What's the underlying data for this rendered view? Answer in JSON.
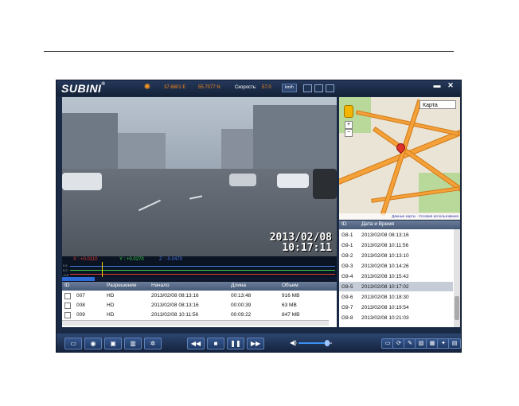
{
  "app": {
    "brand": "SUBINI",
    "brand_sup": "®"
  },
  "titlebar": {
    "latitude": "37.6801 E",
    "longitude": "55.7077 N",
    "speed_label": "Скорость:",
    "speed_value": "57.0",
    "speed_unit": "km/h",
    "minimize_glyph": "▬",
    "close_glyph": "✕",
    "window_icons": [
      "window-single-icon",
      "window-split-icon",
      "window-quad-icon"
    ]
  },
  "video": {
    "date": "2013/02/08",
    "time": "10:17:11"
  },
  "graph": {
    "x_label": "X : +0.0110",
    "y_label": "Y : +0.0270",
    "z_label": "Z : -0.0470",
    "axis_labels": [
      "0.5",
      "0.0",
      "-0.5"
    ],
    "colors": {
      "x": "#e33b3b",
      "y": "#3bd04a",
      "z": "#4a78e8"
    }
  },
  "playback": {
    "progress": 0.12
  },
  "files": {
    "columns": [
      "ID",
      "Разрешение",
      "Начало",
      "Длина",
      "Объем"
    ],
    "rows": [
      {
        "id": "007",
        "res": "HD",
        "start": "2013/02/08 08:13:16",
        "length": "00:13:48",
        "size": "916 MB"
      },
      {
        "id": "008",
        "res": "HD",
        "start": "2013/02/08 08:13:16",
        "length": "00:00:39",
        "size": "63 MB"
      },
      {
        "id": "009",
        "res": "HD",
        "start": "2013/02/08 10:11:56",
        "length": "00:09:22",
        "size": "847 MB"
      }
    ]
  },
  "map": {
    "type_select": "Карта",
    "footer": "Данные карты · Условия использования"
  },
  "index": {
    "columns": [
      "ID",
      "Дата и Время"
    ],
    "rows": [
      {
        "id": "G8-1",
        "dt": "2013/02/08 08:13:16"
      },
      {
        "id": "G9-1",
        "dt": "2013/02/08 10:11:56"
      },
      {
        "id": "G9-2",
        "dt": "2013/02/08 10:13:10"
      },
      {
        "id": "G9-3",
        "dt": "2013/02/08 10:14:26"
      },
      {
        "id": "G9-4",
        "dt": "2013/02/08 10:15:42"
      },
      {
        "id": "G9-5",
        "dt": "2013/02/08 10:17:02"
      },
      {
        "id": "G9-6",
        "dt": "2013/02/08 10:18:30"
      },
      {
        "id": "G9-7",
        "dt": "2013/02/08 10:19:54"
      },
      {
        "id": "G9-8",
        "dt": "2013/02/08 10:21:03"
      }
    ],
    "selected_index": 5
  },
  "toolbar": {
    "left_icons": [
      "folder-icon",
      "camera-icon",
      "save-icon",
      "delete-icon",
      "settings-icon"
    ],
    "left_glyphs": [
      "▭",
      "◉",
      "▣",
      "▥",
      "✲"
    ],
    "transport_icons": [
      "rewind-icon",
      "stop-icon",
      "pause-icon",
      "fast-forward-icon"
    ],
    "transport_glyphs": [
      "◀◀",
      "■",
      "❚❚",
      "▶▶"
    ],
    "volume_level": 0.85,
    "right_icons": [
      "layout-icon",
      "rotate-icon",
      "pen-icon",
      "image-icon",
      "gps-icon",
      "wrench-icon",
      "folder-open-icon"
    ],
    "right_glyphs": [
      "▭",
      "⟳",
      "✎",
      "▧",
      "▦",
      "✦",
      "▤"
    ]
  }
}
